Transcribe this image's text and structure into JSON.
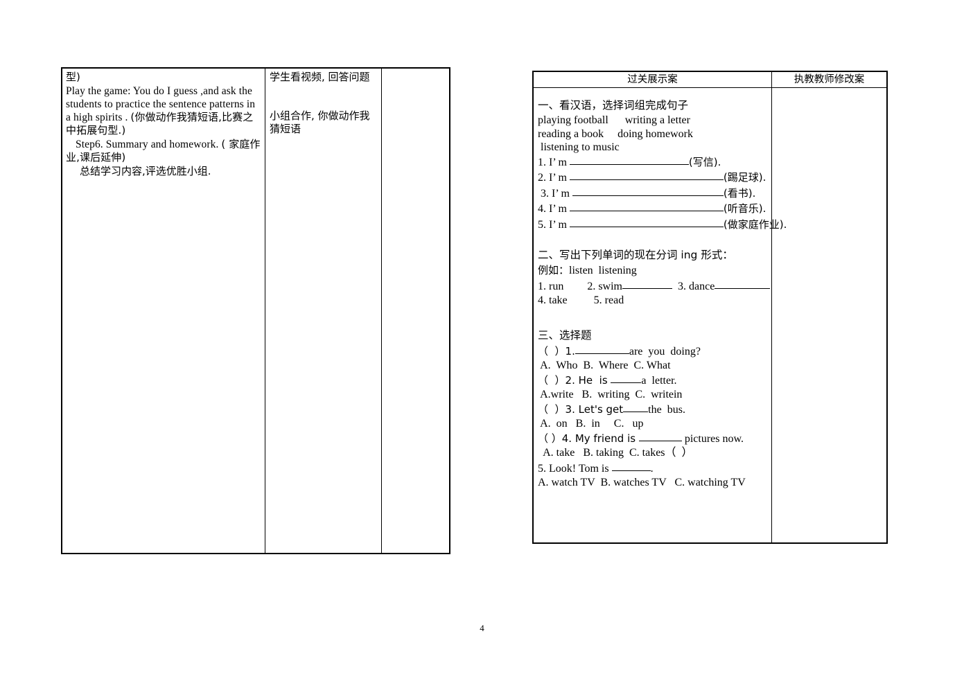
{
  "page": {
    "number": "4"
  },
  "left_table": {
    "col1": {
      "lines": [
        "型)",
        "Play the game: You do I guess ,and ask the",
        "students to practice the sentence patterns in",
        "a high spirits . (你做动作我猜短语,比赛",
        "之中拓展句型.)",
        "Step6. Summary and homework. ( 家庭",
        "作业,课后延伸)",
        "总结学习内容,评选优胜小组."
      ],
      "para_en": "Play the game: You do I guess ,and ask the students to practice the sentence patterns in a high spirits .",
      "para_cn1": "(你做动作我猜短语,比赛之中拓展句型.)",
      "step6_en": "Step6. Summary and homework.",
      "step6_cn": "( 家庭作业,课后延伸)",
      "summary_cn": "总结学习内容,评选优胜小组.",
      "first_line": "型)"
    },
    "col2": {
      "line1": "学生看视频, 回答问题",
      "line2": "小组合作, 你做动作我",
      "line3": "猜短语"
    },
    "col3": {
      "content": ""
    }
  },
  "right_table": {
    "header": {
      "left": "过关展示案",
      "right": "执教教师修改案"
    },
    "section1": {
      "heading": "一、看汉语，选择词组完成句子",
      "phrases_line1": "playing football      writing a letter",
      "phrases_line2": "reading a book     doing homework",
      "phrases_line3": " listening to music",
      "items": [
        {
          "num": "1. I’ m ",
          "blank_width": 172,
          "answer": "(写信)."
        },
        {
          "num": "2. I’ m ",
          "blank_width": 222,
          "answer": "(踢足球)."
        },
        {
          "num": " 3. I’ m ",
          "blank_width": 218,
          "answer": "(看书)."
        },
        {
          "num": "4. I’ m ",
          "blank_width": 222,
          "answer": "(听音乐)."
        },
        {
          "num": "5. I’ m ",
          "blank_width": 222,
          "answer": "(做家庭作业)."
        }
      ]
    },
    "section2": {
      "heading": "二、写出下列单词的现在分词 ing 形式：",
      "example": "例如：listen  listening",
      "line1_a": "1. run",
      "line1_b": "2. swim",
      "line1_c": "3. dance",
      "line2_a": "4. take",
      "line2_b": "5. read"
    },
    "section3": {
      "heading": "三、选择题",
      "q1": "（  ）1.",
      "q1_tail": "are  you  doing?",
      "q1_opts": " A.  Who  B.  Where  C. What",
      "q2": "（  ）2. He  is ",
      "q2_tail": "a  letter.",
      "q2_opts": " A.write   B.  writing  C.  writein",
      "q3": "（  ）3. Let's get",
      "q3_tail": "the  bus.",
      "q3_opts": " A.  on   B.  in     C.   up",
      "q4": "（ ）4. My friend is ",
      "q4_tail": " pictures now.",
      "q4_opts": "  A. take   B. taking  C. takes（  ）",
      "q5": "5. Look! Tom is ",
      "q5_tail": ".",
      "q5_opts": "A. watch TV  B. watches TV   C. watching TV"
    }
  }
}
